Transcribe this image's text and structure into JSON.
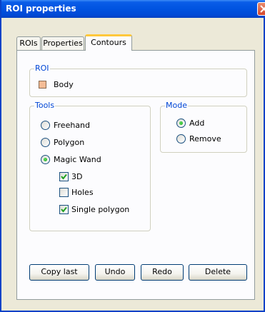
{
  "window": {
    "title": "ROI properties"
  },
  "tabs": [
    {
      "label": "ROIs"
    },
    {
      "label": "Properties"
    },
    {
      "label": "Contours",
      "active": true
    }
  ],
  "roi_group": {
    "legend": "ROI",
    "item_label": "Body",
    "swatch_color": "#f4bc96"
  },
  "tools_group": {
    "legend": "Tools",
    "options": [
      {
        "label": "Freehand",
        "selected": false
      },
      {
        "label": "Polygon",
        "selected": false
      },
      {
        "label": "Magic Wand",
        "selected": true
      }
    ],
    "sub_options": [
      {
        "label": "3D",
        "checked": true
      },
      {
        "label": "Holes",
        "checked": false
      },
      {
        "label": "Single polygon",
        "checked": true
      }
    ]
  },
  "mode_group": {
    "legend": "Mode",
    "options": [
      {
        "label": "Add",
        "selected": true
      },
      {
        "label": "Remove",
        "selected": false
      }
    ]
  },
  "buttons": {
    "copy_last": "Copy last",
    "undo": "Undo",
    "redo": "Redo",
    "delete": "Delete"
  },
  "colors": {
    "title_bar": "#0053e0",
    "active_tab_accent": "#ffc83c",
    "group_legend": "#0046d5"
  }
}
